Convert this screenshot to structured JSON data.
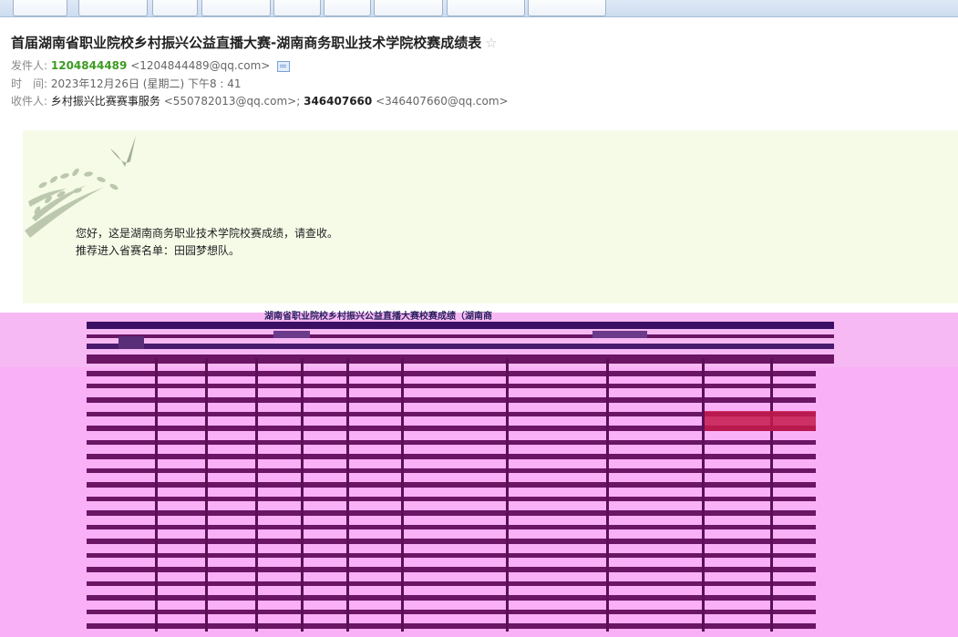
{
  "email": {
    "subject": "首届湖南省职业院校乡村振兴公益直播大赛-湖南商务职业技术学院校赛成绩表",
    "from_label": "发件人:",
    "from_name": "1204844489",
    "from_addr": "<1204844489@qq.com>",
    "time_label": "时　间:",
    "time_value": "2023年12月26日 (星期二) 下午8 : 41",
    "to_label": "收件人:",
    "to_1_name": "乡村振兴比赛赛事服务",
    "to_1_addr": "<550782013@qq.com>;",
    "to_2_name": "346407660",
    "to_2_addr": "<346407660@qq.com>"
  },
  "message": {
    "line1": "您好，这是湖南商务职业技术学院校赛成绩，请查收。",
    "line2": "推荐进入省赛名单：田园梦想队。"
  },
  "sheet": {
    "title": "湖南省职业院校乡村振兴公益直播大赛校赛成绩（湖南商"
  },
  "icons": {
    "star": "star-icon",
    "contact_card": "contact-card-icon",
    "branch": "bird-branch-decoration"
  },
  "colors": {
    "sender_green": "#3d9b22",
    "glitch_magenta": "#f9b4f6",
    "glitch_purple": "#6b1565",
    "panel_bg": "#f6fbe8"
  }
}
